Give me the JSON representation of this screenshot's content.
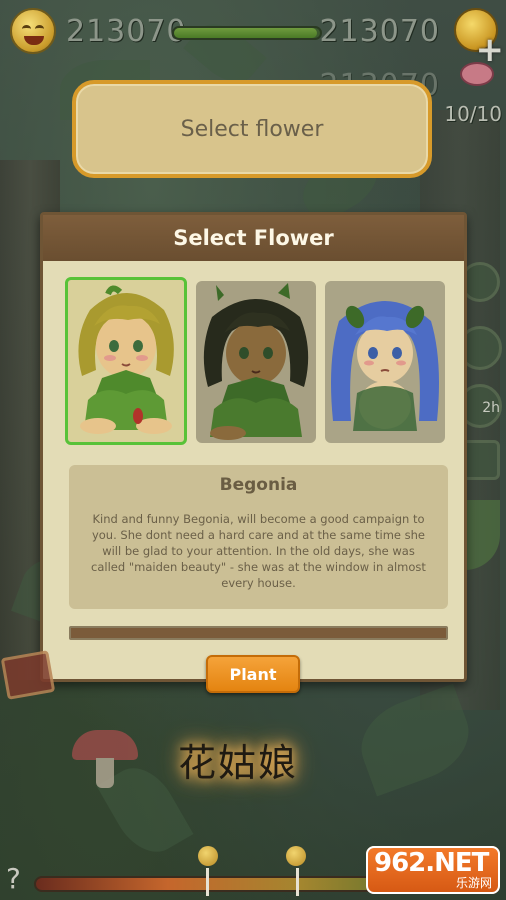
{
  "hud": {
    "score_left": "213070",
    "score_right": "213070",
    "score_right_faded": "213070",
    "energy_fraction": 0.98,
    "count": "10/10",
    "plus_label": "+"
  },
  "tooltip": {
    "text": "Select flower"
  },
  "dialog": {
    "title": "Select Flower",
    "flowers": [
      {
        "name": "blonde flower girl",
        "selected": true
      },
      {
        "name": "dark-haired flower girl",
        "selected": false
      },
      {
        "name": "blue-haired flower girl",
        "selected": false
      }
    ],
    "description": {
      "title": "Begonia",
      "text": "Kind and funny Begonia, will become a good campaign to you. She dont need a hard care and at the same time she will  be glad to your attention. In the old days, she was called \"maiden beauty\" - she was at the window in almost every house."
    },
    "progress_fraction": 1.0,
    "plant_label": "Plant"
  },
  "side": {
    "timer": "2h"
  },
  "calligraphy": "花姑娘",
  "bottom": {
    "help_label": "?"
  },
  "watermark": {
    "brand": "962.NET",
    "sub": "乐游网"
  },
  "colors": {
    "dialog_bg": "#e3dcb6",
    "header_bg": "#6a4e30",
    "button": "#e48410",
    "selected_border": "#58c238"
  }
}
